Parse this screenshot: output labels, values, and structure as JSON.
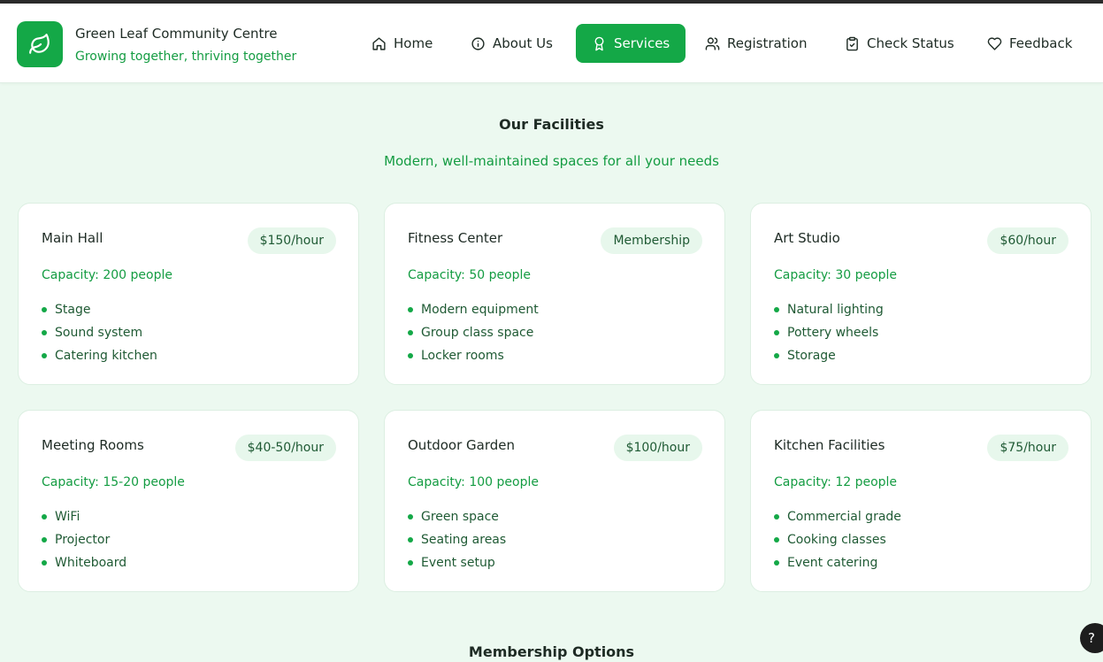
{
  "brand": {
    "name": "Green Leaf Community Centre",
    "tagline": "Growing together, thriving together",
    "logo_icon": "leaf-icon",
    "accent": "#14a847"
  },
  "nav": {
    "items": [
      {
        "label": "Home",
        "icon": "home-icon"
      },
      {
        "label": "About Us",
        "icon": "info-icon"
      },
      {
        "label": "Services",
        "icon": "award-icon",
        "active": true
      },
      {
        "label": "Registration",
        "icon": "users-icon"
      },
      {
        "label": "Check Status",
        "icon": "clipboard-check-icon"
      },
      {
        "label": "Feedback",
        "icon": "heart-icon"
      }
    ]
  },
  "facilities": {
    "title": "Our Facilities",
    "subtitle": "Modern, well-maintained spaces for all your needs",
    "cards": [
      {
        "name": "Main Hall",
        "price": "$150/hour",
        "capacity": "Capacity: 200 people",
        "features": [
          "Stage",
          "Sound system",
          "Catering kitchen"
        ]
      },
      {
        "name": "Fitness Center",
        "price": "Membership",
        "capacity": "Capacity: 50 people",
        "features": [
          "Modern equipment",
          "Group class space",
          "Locker rooms"
        ]
      },
      {
        "name": "Art Studio",
        "price": "$60/hour",
        "capacity": "Capacity: 30 people",
        "features": [
          "Natural lighting",
          "Pottery wheels",
          "Storage"
        ]
      },
      {
        "name": "Meeting Rooms",
        "price": "$40-50/hour",
        "capacity": "Capacity: 15-20 people",
        "features": [
          "WiFi",
          "Projector",
          "Whiteboard"
        ]
      },
      {
        "name": "Outdoor Garden",
        "price": "$100/hour",
        "capacity": "Capacity: 100 people",
        "features": [
          "Green space",
          "Seating areas",
          "Event setup"
        ]
      },
      {
        "name": "Kitchen Facilities",
        "price": "$75/hour",
        "capacity": "Capacity: 12 people",
        "features": [
          "Commercial grade",
          "Cooking classes",
          "Event catering"
        ]
      }
    ]
  },
  "membership": {
    "title": "Membership Options"
  },
  "help": {
    "label": "?"
  }
}
